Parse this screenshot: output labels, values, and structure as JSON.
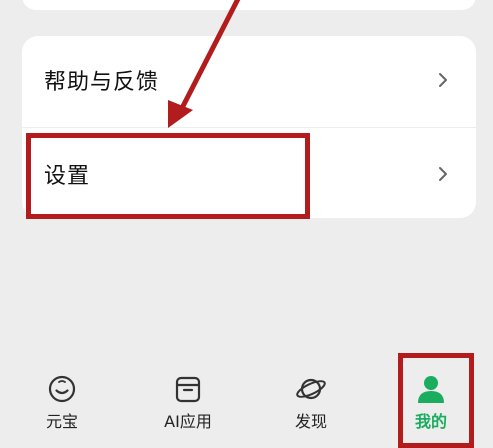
{
  "settings_list": {
    "help_feedback_label": "帮助与反馈",
    "settings_label": "设置"
  },
  "tabbar": {
    "tabs": [
      {
        "label": "元宝",
        "icon": "yuanbao-chat-icon",
        "active": false
      },
      {
        "label": "AI应用",
        "icon": "ai-apps-box-icon",
        "active": false
      },
      {
        "label": "发现",
        "icon": "planet-discover-icon",
        "active": false
      },
      {
        "label": "我的",
        "icon": "person-profile-icon",
        "active": true
      }
    ]
  },
  "colors": {
    "background": "#ededed",
    "card": "#ffffff",
    "accent_green": "#1aad5e",
    "annotation_red": "#b21c1c"
  },
  "annotations": {
    "type": "red highlight boxes and arrow",
    "targets": [
      "settings-row",
      "tab-mine"
    ]
  }
}
